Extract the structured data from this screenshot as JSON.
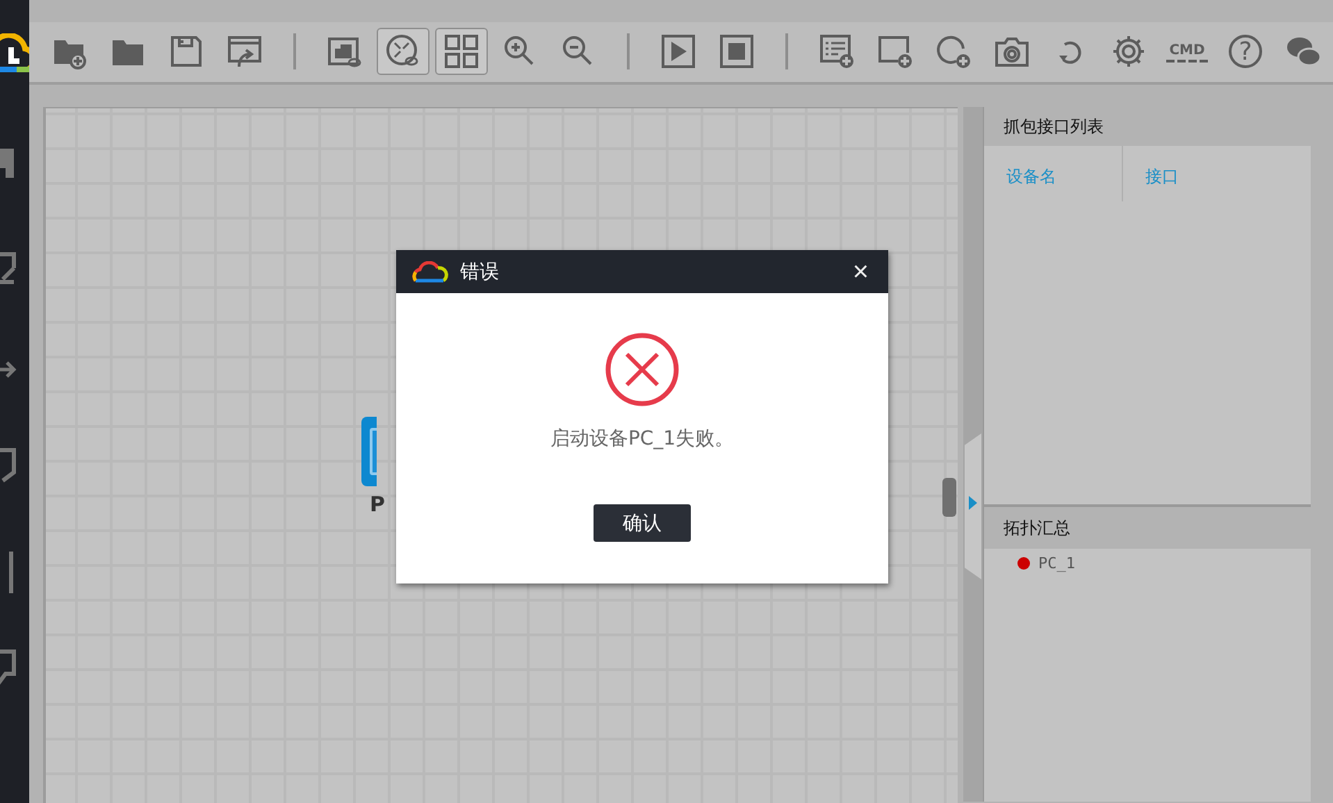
{
  "toolbar": [
    {
      "kind": "new-project",
      "on": false
    },
    {
      "kind": "open",
      "on": false
    },
    {
      "kind": "save",
      "on": false
    },
    {
      "kind": "export",
      "on": false
    },
    {
      "kind": "separator"
    },
    {
      "kind": "device-view",
      "on": false
    },
    {
      "kind": "topology-view",
      "on": true
    },
    {
      "kind": "grid",
      "on": true
    },
    {
      "kind": "zoom-in",
      "on": false
    },
    {
      "kind": "zoom-out",
      "on": false
    },
    {
      "kind": "separator"
    },
    {
      "kind": "start",
      "on": false
    },
    {
      "kind": "stop",
      "on": false
    },
    {
      "kind": "separator"
    },
    {
      "kind": "add-list",
      "on": false
    },
    {
      "kind": "add-rect",
      "on": false
    },
    {
      "kind": "add-ellipse",
      "on": false
    },
    {
      "kind": "camera",
      "on": false
    },
    {
      "kind": "refresh",
      "on": false
    },
    {
      "kind": "settings",
      "on": false
    },
    {
      "kind": "cmd",
      "on": false,
      "label": "CMD"
    },
    {
      "kind": "help",
      "on": false,
      "label": "?"
    },
    {
      "kind": "chat",
      "on": false
    }
  ],
  "canvas": {
    "nodes": [
      {
        "label": "P"
      }
    ]
  },
  "capture_panel": {
    "title": "抓包接口列表",
    "columns": [
      "设备名",
      "接口"
    ]
  },
  "topology_panel": {
    "title": "拓扑汇总",
    "items": [
      {
        "name": "PC_1",
        "color": "#cc0000"
      }
    ]
  },
  "dialog": {
    "title": "错误",
    "close": "×",
    "message": "启动设备PC_1失败。",
    "button": "确认"
  }
}
